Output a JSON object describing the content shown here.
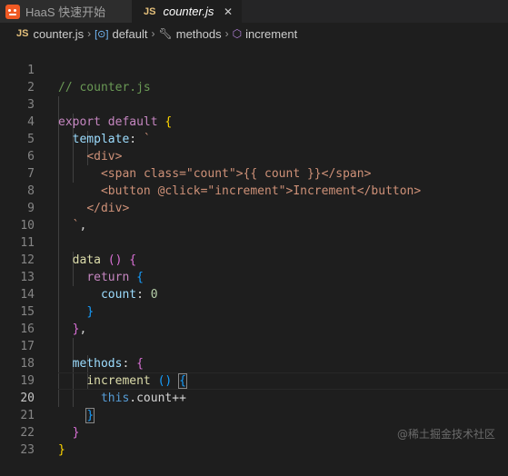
{
  "tabs": [
    {
      "label": "HaaS 快速开始",
      "icon": "haas-icon",
      "active": false
    },
    {
      "label": "counter.js",
      "icon": "js-badge",
      "badge": "JS",
      "active": true
    }
  ],
  "breadcrumb": {
    "file_badge": "JS",
    "file": "counter.js",
    "export": "default",
    "methods": "methods",
    "method": "increment"
  },
  "line_numbers": [
    "1",
    "2",
    "3",
    "4",
    "5",
    "6",
    "7",
    "8",
    "9",
    "10",
    "11",
    "12",
    "13",
    "14",
    "15",
    "16",
    "17",
    "18",
    "19",
    "20",
    "21",
    "22",
    "23"
  ],
  "code": {
    "l1": "// counter.js",
    "l3_export": "export",
    "l3_default": "default",
    "l4_template": "template",
    "l5_div_open": "<div>",
    "l6_span_open": "<span",
    "l6_class_attr": "class",
    "l6_class_val": "\"count\"",
    "l6_interp": "{{ count }}",
    "l6_span_close": "</span>",
    "l7_button_open": "<button",
    "l7_click_attr": "@click",
    "l7_click_val": "\"increment\"",
    "l7_text": "Increment",
    "l7_button_close": "</button>",
    "l8_div_close": "</div>",
    "l11_data": "data",
    "l12_return": "return",
    "l13_count": "count",
    "l13_zero": "0",
    "l17_methods": "methods",
    "l18_increment": "increment",
    "l19_this": "this",
    "l19_rest": ".count++"
  },
  "watermark": "@稀土掘金技术社区",
  "colors": {
    "background": "#1e1e1e",
    "tab_active_fg": "#ffffff",
    "comment": "#6a9955",
    "keyword": "#c586c0",
    "string": "#ce9178"
  }
}
